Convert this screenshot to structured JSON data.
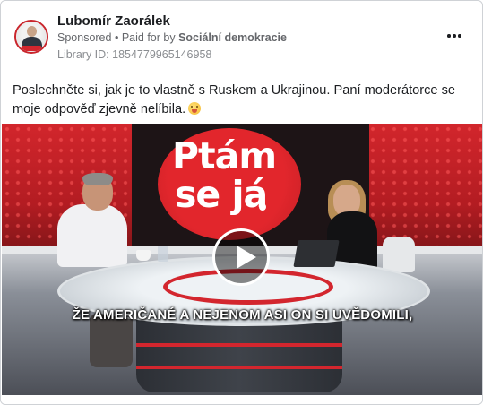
{
  "post": {
    "author": "Lubomír Zaorálek",
    "sponsored": "Sponsored",
    "separator": "•",
    "paid_for_prefix": "Paid for by",
    "paid_for_by": "Sociální demokracie",
    "library_id": "Library ID: 1854779965146958",
    "text": "Poslechněte si, jak je to vlastně s Ruskem a Ukrajinou. Paní moderátorce se moje odpověď zjevně nelíbila."
  },
  "video": {
    "logo_line1": "Ptám",
    "logo_line2": "se já",
    "subtitle": "ŽE AMERIČANÉ A NEJENOM ASI ON SI UVĚDOMILI,"
  },
  "icons": {
    "more": "more-horizontal-icon",
    "play": "play-icon",
    "emoji": "flushed-face-emoji"
  },
  "colors": {
    "brand_red": "#d3262e",
    "text_primary": "#1c1e21",
    "text_secondary": "#65676b"
  }
}
